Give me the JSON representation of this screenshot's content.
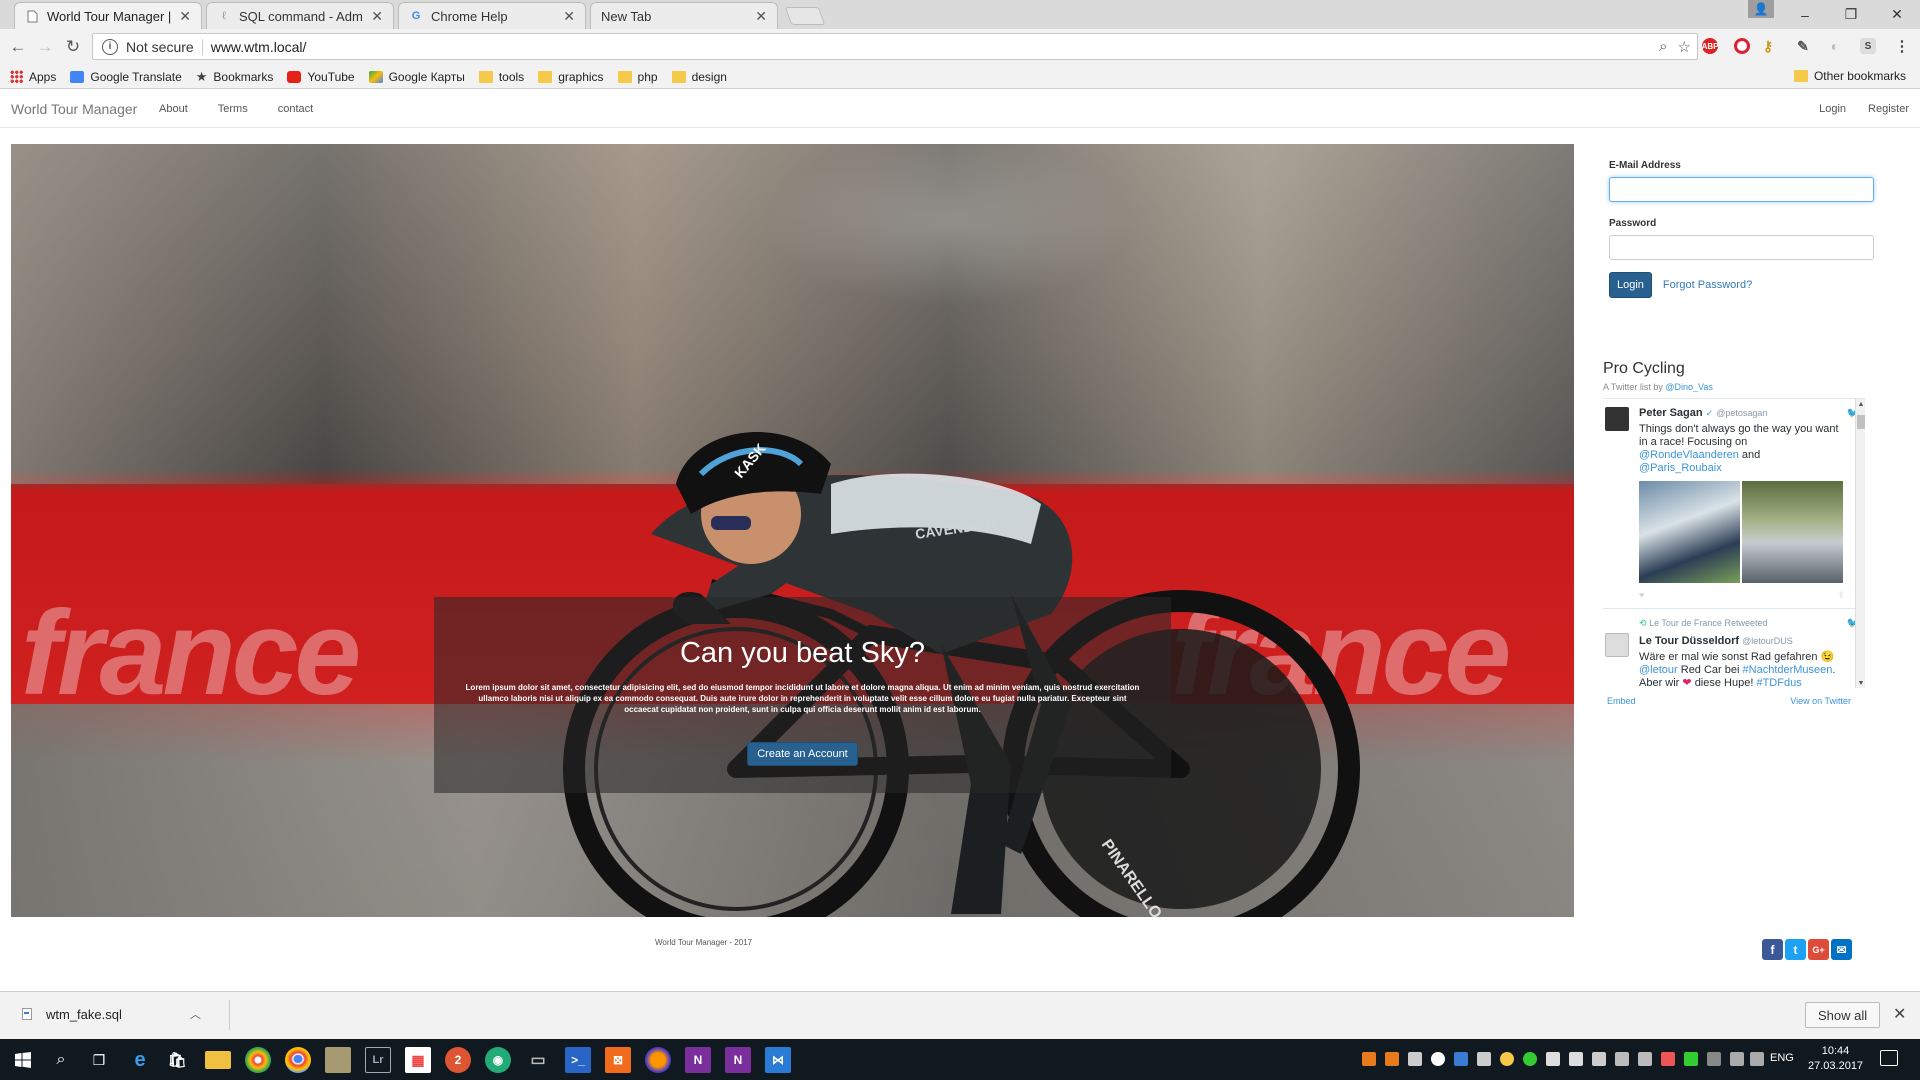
{
  "browser": {
    "tabs": [
      {
        "title": "World Tour Manager | Pa",
        "active": true
      },
      {
        "title": "SQL command - Admine",
        "active": false
      },
      {
        "title": "Chrome Help",
        "active": false
      },
      {
        "title": "New Tab",
        "active": false
      }
    ],
    "window_controls": {
      "minimize": "–",
      "maximize": "❐",
      "close": "✕"
    },
    "security_label": "Not secure",
    "url": "www.wtm.local/",
    "bookmarks": [
      "Apps",
      "Google Translate",
      "Bookmarks",
      "YouTube",
      "Google Карты",
      "tools",
      "graphics",
      "php",
      "design"
    ],
    "other_bookmarks": "Other bookmarks"
  },
  "site": {
    "brand": "World Tour Manager",
    "nav": [
      "About",
      "Terms",
      "contact"
    ],
    "nav_right": [
      "Login",
      "Register"
    ],
    "hero": {
      "heading": "Can you beat Sky?",
      "body": "Lorem ipsum dolor sit amet, consectetur adipisicing elit, sed do eiusmod tempor incididunt ut labore et dolore magna aliqua. Ut enim ad minim veniam, quis nostrud exercitation ullamco laboris nisi ut aliquip ex ea commodo consequat. Duis aute irure dolor in reprehenderit in voluptate velit esse cillum dolore eu fugiat nulla pariatur. Excepteur sint occaecat cupidatat non proident, sunt in culpa qui officia deserunt mollit anim id est laborum.",
      "cta": "Create an Account",
      "wordmark": "france",
      "jersey_text": "CAVENDISH",
      "helmet_text": "KASK",
      "bike_text": "PINARELLO"
    },
    "login": {
      "email_label": "E-Mail Address",
      "email_value": "",
      "password_label": "Password",
      "password_value": "",
      "button": "Login",
      "forgot": "Forgot Password?"
    },
    "twitter": {
      "title": "Pro Cycling",
      "subtitle_prefix": "A Twitter list by",
      "subtitle_handle": "@Dino_Vas",
      "tweets": [
        {
          "name": "Peter Sagan",
          "verified": "✓",
          "handle": "@petosagan",
          "text_1": "Things don't always go the way you want in a race! Focusing on",
          "link_1": "@RondeVlaanderen",
          "text_2": "and",
          "link_2": "@Paris_Roubaix"
        },
        {
          "retweet": "Le Tour de France Retweeted",
          "name": "Le Tour Düsseldorf",
          "handle": "@letourDUS",
          "text_1": "Wäre er mal wie sonst Rad gefahren 😉",
          "link_1": "@letour",
          "text_2": "Red Car bei",
          "link_2": "#NachtderMuseen",
          "text_3": ". Aber wir",
          "text_4": "diese Hupe!",
          "link_3": "#TDFdus"
        }
      ],
      "embed": "Embed",
      "view_on": "View on Twitter"
    },
    "footer": "World Tour Manager - 2017",
    "share": [
      "f",
      "t",
      "G+",
      "✉"
    ]
  },
  "downloads": {
    "file": "wtm_fake.sql",
    "show_all": "Show all"
  },
  "taskbar": {
    "lang": "ENG",
    "time": "10:44",
    "date": "27.03.2017"
  },
  "colors": {
    "primary": "#286090",
    "link": "#337ab7",
    "twitter_blue": "#3b94d9",
    "facebook": "#3b5998",
    "twitter": "#1da1f2",
    "google": "#dd4b39",
    "email": "#0072c6"
  }
}
